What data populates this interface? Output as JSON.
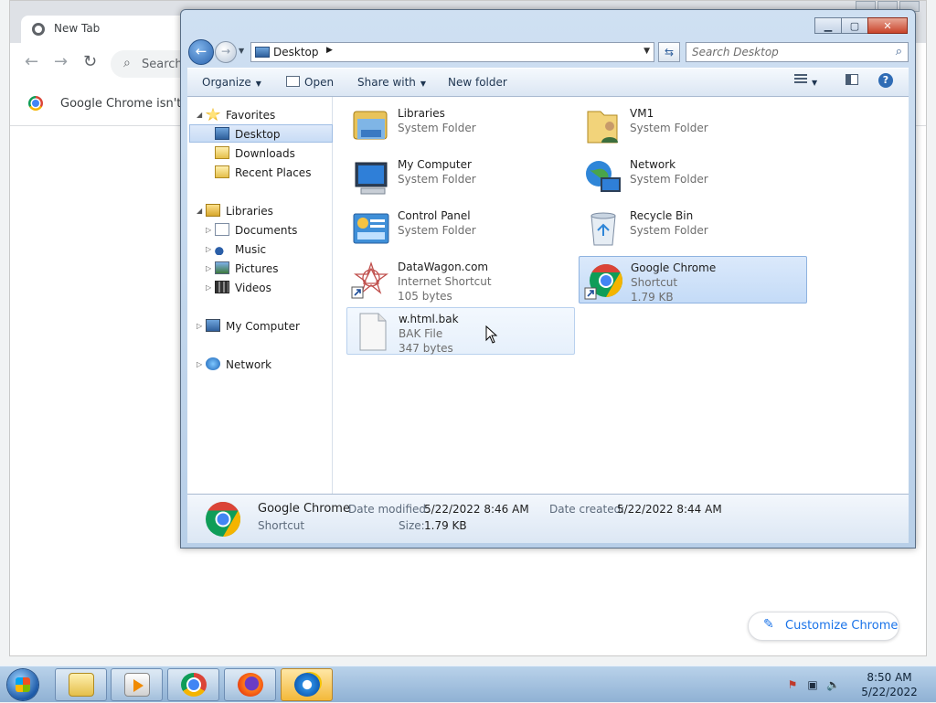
{
  "chrome": {
    "tab_title": "New Tab",
    "omnibox_placeholder": "Search",
    "infobar_text": "Google Chrome isn't yo",
    "customize_label": "Customize Chrome"
  },
  "explorer": {
    "address": {
      "segment": "Desktop"
    },
    "search_placeholder": "Search Desktop",
    "commands": {
      "organize": "Organize",
      "open": "Open",
      "share_with": "Share with",
      "new_folder": "New folder"
    },
    "nav": {
      "favorites": {
        "label": "Favorites",
        "items": [
          "Desktop",
          "Downloads",
          "Recent Places"
        ]
      },
      "libraries": {
        "label": "Libraries",
        "items": [
          "Documents",
          "Music",
          "Pictures",
          "Videos"
        ]
      },
      "my_computer": "My Computer",
      "network": "Network"
    },
    "files": [
      {
        "name": "Libraries",
        "type": "System Folder",
        "size": "",
        "icon": "libraries-icon"
      },
      {
        "name": "VM1",
        "type": "System Folder",
        "size": "",
        "icon": "user-folder-icon"
      },
      {
        "name": "My Computer",
        "type": "System Folder",
        "size": "",
        "icon": "computer-icon"
      },
      {
        "name": "Network",
        "type": "System Folder",
        "size": "",
        "icon": "network-icon"
      },
      {
        "name": "Control Panel",
        "type": "System Folder",
        "size": "",
        "icon": "control-panel-icon"
      },
      {
        "name": "Recycle Bin",
        "type": "System Folder",
        "size": "",
        "icon": "recycle-bin-icon"
      },
      {
        "name": "DataWagon.com",
        "type": "Internet Shortcut",
        "size": "105 bytes",
        "icon": "internet-shortcut-icon"
      },
      {
        "name": "Google Chrome",
        "type": "Shortcut",
        "size": "1.79 KB",
        "icon": "chrome-icon"
      },
      {
        "name": "w.html.bak",
        "type": "BAK File",
        "size": "347 bytes",
        "icon": "blank-file-icon"
      }
    ],
    "details": {
      "name": "Google Chrome",
      "type": "Shortcut",
      "modified_label": "Date modified:",
      "modified_value": "5/22/2022 8:46 AM",
      "created_label": "Date created:",
      "created_value": "5/22/2022 8:44 AM",
      "size_label": "Size:",
      "size_value": "1.79 KB"
    }
  },
  "taskbar": {
    "time": "8:50 AM",
    "date": "5/22/2022",
    "apps": [
      "windows-explorer",
      "media-player",
      "google-chrome",
      "firefox",
      "internet-explorer"
    ]
  }
}
